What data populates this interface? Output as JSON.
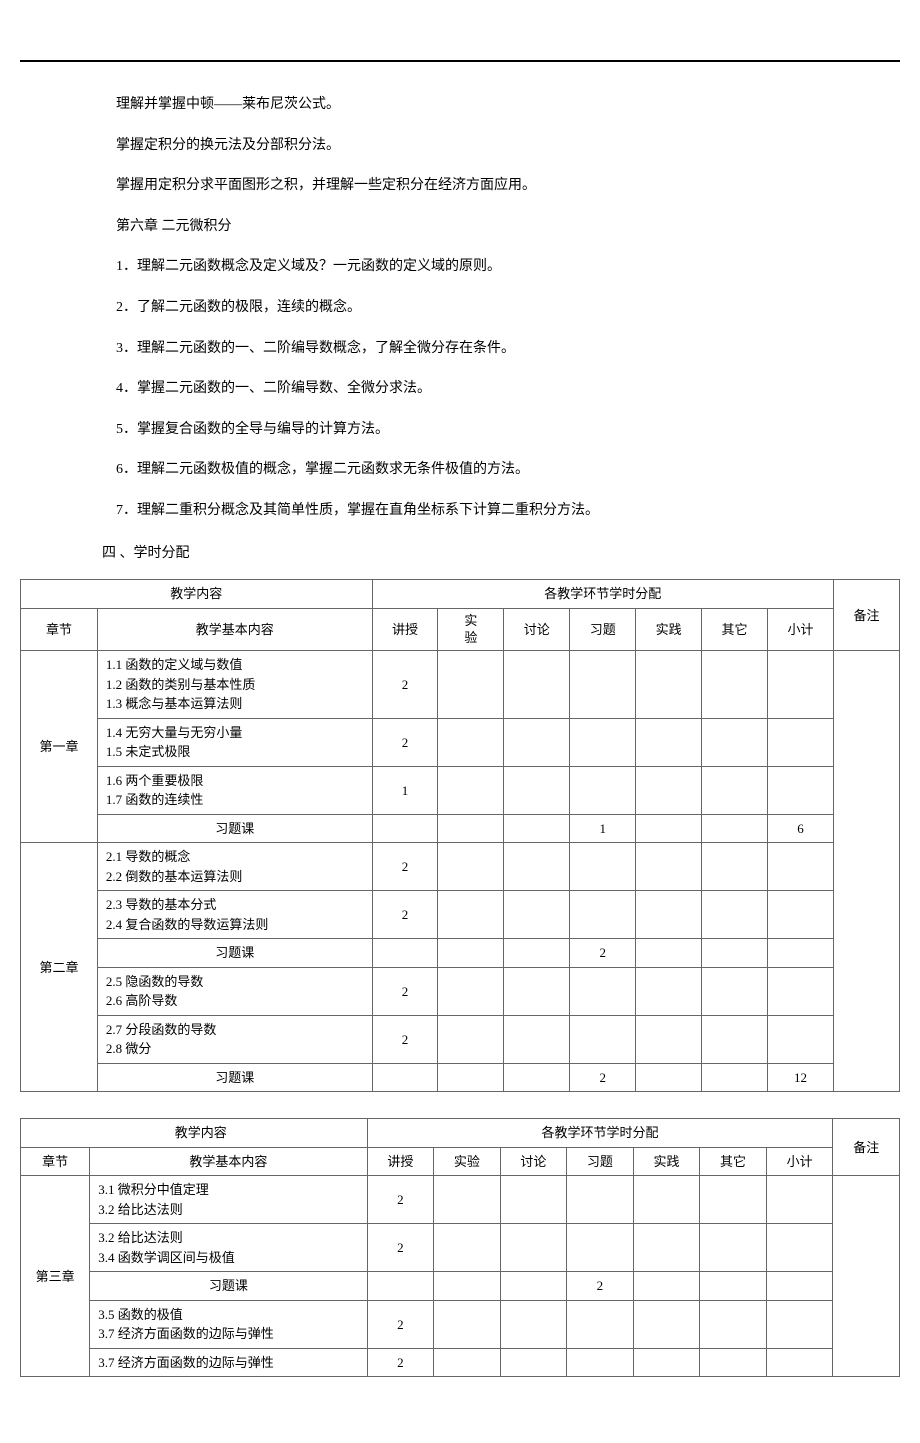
{
  "intro": {
    "p1": "理解并掌握中顿——莱布尼茨公式。",
    "p2": "掌握定积分的换元法及分部积分法。",
    "p3": "掌握用定积分求平面图形之积，并理解一些定积分在经济方面应用。"
  },
  "chapter6": {
    "title": "第六章  二元微积分",
    "items": [
      "1．理解二元函数概念及定义域及？一元函数的定义域的原则。",
      "2．了解二元函数的极限，连续的概念。",
      "3．理解二元函数的一、二阶编导数概念，了解全微分存在条件。",
      "4．掌握二元函数的一、二阶编导数、全微分求法。",
      "5．掌握复合函数的全导与编导的计算方法。",
      "6．理解二元函数极值的概念，掌握二元函数求无条件极值的方法。",
      "7．理解二重积分概念及其简单性质，掌握在直角坐标系下计算二重积分方法。"
    ]
  },
  "heading4": "四 、学时分配",
  "tableHeaders": {
    "teachContent": "教学内容",
    "distribution": "各教学环节学时分配",
    "chapter": "章节",
    "basicContent": "教学基本内容",
    "lecture": "讲授",
    "experiment": "实验",
    "experimentV": "实\n验",
    "discuss": "讨论",
    "exercise": "习题",
    "practice": "实践",
    "other": "其它",
    "subtotal": "小计",
    "remark": "备注"
  },
  "table1": {
    "rows": [
      {
        "chapter": "第一章",
        "content": "1.1 函数的定义域与数值\n1.2 函数的类别与基本性质\n1.3 概念与基本运算法则",
        "lecture": "2",
        "exercise": "",
        "subtotal": "",
        "rowspan": 4
      },
      {
        "content": "1.4 无穷大量与无穷小量\n1.5 未定式极限",
        "lecture": "2",
        "exercise": "",
        "subtotal": ""
      },
      {
        "content": "1.6 两个重要极限\n1.7 函数的连续性",
        "lecture": "1",
        "exercise": "",
        "subtotal": ""
      },
      {
        "content": "习题课",
        "lecture": "",
        "exercise": "1",
        "subtotal": "6",
        "centerContent": true
      },
      {
        "chapter": "第二章",
        "content": "2.1 导数的概念\n2.2 倒数的基本运算法则",
        "lecture": "2",
        "exercise": "",
        "subtotal": "",
        "rowspan": 6
      },
      {
        "content": "2.3 导数的基本分式\n2.4 复合函数的导数运算法则",
        "lecture": "2",
        "exercise": "",
        "subtotal": ""
      },
      {
        "content": "习题课",
        "lecture": "",
        "exercise": "2",
        "subtotal": "",
        "centerContent": true
      },
      {
        "content": "2.5 隐函数的导数\n2.6 高阶导数",
        "lecture": "2",
        "exercise": "",
        "subtotal": ""
      },
      {
        "content": "2.7 分段函数的导数\n2.8 微分",
        "lecture": "2",
        "exercise": "",
        "subtotal": ""
      },
      {
        "content": "习题课",
        "lecture": "",
        "exercise": "2",
        "subtotal": "12",
        "centerContent": true
      }
    ]
  },
  "table2": {
    "rows": [
      {
        "chapter": "第三章",
        "content": "3.1 微积分中值定理\n3.2 给比达法则",
        "lecture": "2",
        "exercise": "",
        "subtotal": "",
        "rowspan": 5
      },
      {
        "content": "3.2 给比达法则\n3.4 函数学调区间与极值",
        "lecture": "2",
        "exercise": "",
        "subtotal": ""
      },
      {
        "content": "习题课",
        "lecture": "",
        "exercise": "2",
        "subtotal": "",
        "centerContent": true
      },
      {
        "content": "3.5 函数的极值\n3.7 经济方面函数的边际与弹性",
        "lecture": "2",
        "exercise": "",
        "subtotal": ""
      },
      {
        "content": "3.7 经济方面函数的边际与弹性",
        "lecture": "2",
        "exercise": "",
        "subtotal": ""
      }
    ]
  }
}
